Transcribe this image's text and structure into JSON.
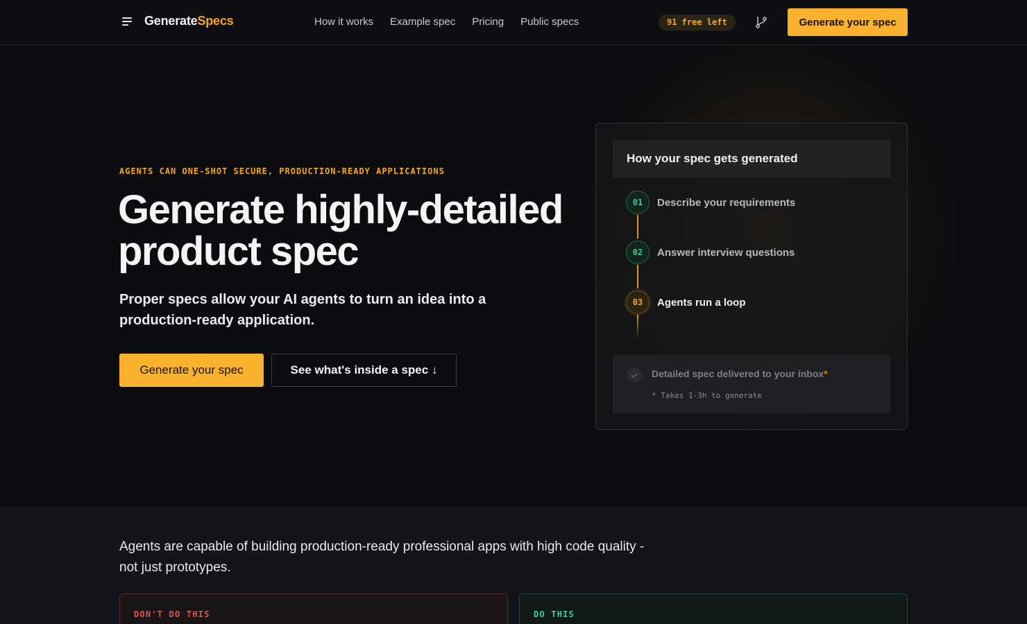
{
  "nav": {
    "logo_main": "Generate",
    "logo_accent": "Specs",
    "links": [
      "How it works",
      "Example spec",
      "Pricing",
      "Public specs"
    ],
    "free_badge": "91 free left",
    "cta": "Generate your spec"
  },
  "hero": {
    "eyebrow": "AGENTS CAN ONE-SHOT SECURE, PRODUCTION-READY APPLICATIONS",
    "title": "Generate highly-detailed product spec",
    "subtitle": "Proper specs allow your AI agents to turn an idea into a production-ready application.",
    "primary_cta": "Generate your spec",
    "secondary_cta": "See what's inside a spec ↓"
  },
  "card": {
    "title": "How your spec gets generated",
    "steps": [
      {
        "num": "01",
        "label": "Describe your requirements",
        "state": "done"
      },
      {
        "num": "02",
        "label": "Answer interview questions",
        "state": "done"
      },
      {
        "num": "03",
        "label": "Agents run a loop",
        "state": "active"
      }
    ],
    "footer_text": "Detailed spec delivered to your inbox",
    "footer_star": "*",
    "footer_note": "* Takes 1-3h to generate"
  },
  "section2": {
    "text": "Agents are capable of building production-ready professional apps with high code quality - not just prototypes.",
    "dont_label": "DON'T DO THIS",
    "do_label": "DO THIS"
  },
  "colors": {
    "accent": "#f9b12e",
    "success": "#3ecf8e",
    "danger": "#e5534b",
    "background": "#0c0d10"
  }
}
